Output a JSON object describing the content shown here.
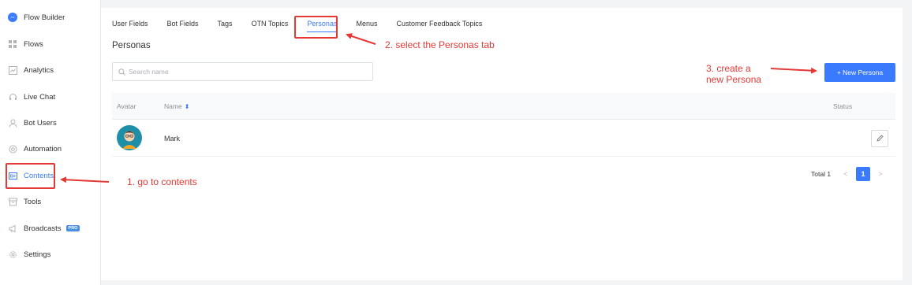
{
  "sidebar": {
    "items": [
      {
        "label": "Flow Builder",
        "icon": "messenger-icon"
      },
      {
        "label": "Flows",
        "icon": "grid-icon"
      },
      {
        "label": "Analytics",
        "icon": "chart-icon"
      },
      {
        "label": "Live Chat",
        "icon": "headset-icon"
      },
      {
        "label": "Bot Users",
        "icon": "user-icon"
      },
      {
        "label": "Automation",
        "icon": "automation-icon"
      },
      {
        "label": "Contents",
        "icon": "contents-icon"
      },
      {
        "label": "Tools",
        "icon": "tools-icon"
      },
      {
        "label": "Broadcasts",
        "icon": "megaphone-icon",
        "badge": "PRO"
      },
      {
        "label": "Settings",
        "icon": "gear-icon"
      }
    ]
  },
  "tabs": [
    {
      "label": "User Fields"
    },
    {
      "label": "Bot Fields"
    },
    {
      "label": "Tags"
    },
    {
      "label": "OTN Topics"
    },
    {
      "label": "Personas"
    },
    {
      "label": "Menus"
    },
    {
      "label": "Customer Feedback Topics"
    }
  ],
  "page": {
    "title": "Personas",
    "search_placeholder": "Search name",
    "new_button": "+ New Persona"
  },
  "table": {
    "headers": {
      "avatar": "Avatar",
      "name": "Name",
      "status": "Status"
    },
    "rows": [
      {
        "name": "Mark"
      }
    ]
  },
  "pagination": {
    "total": "Total 1",
    "current": "1",
    "prev": "<",
    "next": ">"
  },
  "annotations": {
    "step1": "1. go to contents",
    "step2": "2. select the Personas tab",
    "step3_line1": "3. create a",
    "step3_line2": "new Persona"
  },
  "colors": {
    "accent": "#3a7afe",
    "annotation": "#e53935"
  }
}
